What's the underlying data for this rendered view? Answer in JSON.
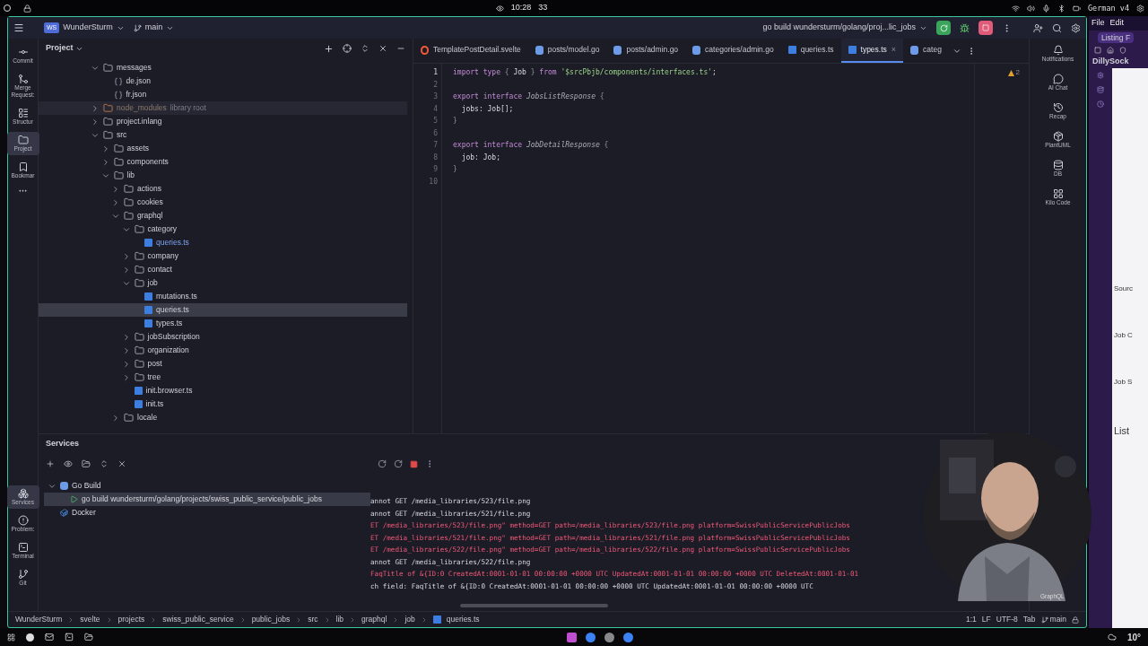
{
  "system_bar": {
    "time": "10:28",
    "count": "33",
    "keyboard": "German v4"
  },
  "title_bar": {
    "project_badge": "WS",
    "project": "WunderSturm",
    "branch": "main",
    "run_config": "go build wundersturm/golang/proj...lic_jobs"
  },
  "left_tools": [
    {
      "label": "Commit",
      "selected": false
    },
    {
      "label": "Merge Request:",
      "selected": false
    },
    {
      "label": "Structur",
      "selected": false
    },
    {
      "label": "Project",
      "selected": true
    },
    {
      "label": "Bookmar",
      "selected": false
    }
  ],
  "bottom_tools": [
    {
      "label": "Services",
      "selected": true
    },
    {
      "label": "Problem:",
      "selected": false
    },
    {
      "label": "Terminal",
      "selected": false
    },
    {
      "label": "Git",
      "selected": false
    }
  ],
  "project_panel": {
    "title": "Project",
    "tree": [
      {
        "name": "messages",
        "kind": "folder",
        "expanded": true,
        "selected": false,
        "children": [
          {
            "name": "de.json",
            "kind": "json",
            "selected": false
          },
          {
            "name": "fr.json",
            "kind": "json",
            "selected": false
          }
        ]
      },
      {
        "name": "node_modules",
        "suffix": "library root",
        "kind": "excluded",
        "expanded": false,
        "selected": false
      },
      {
        "name": "project.inlang",
        "kind": "folder",
        "expanded": false,
        "selected": false
      },
      {
        "name": "src",
        "kind": "folder",
        "expanded": true,
        "selected": false,
        "children": [
          {
            "name": "assets",
            "kind": "folder",
            "expanded": false,
            "selected": false
          },
          {
            "name": "components",
            "kind": "folder",
            "expanded": false,
            "selected": false
          },
          {
            "name": "lib",
            "kind": "folder",
            "expanded": true,
            "selected": false,
            "children": [
              {
                "name": "actions",
                "kind": "folder",
                "expanded": false,
                "selected": false
              },
              {
                "name": "cookies",
                "kind": "folder",
                "expanded": false,
                "selected": false
              },
              {
                "name": "graphql",
                "kind": "folder",
                "expanded": true,
                "selected": false,
                "children": [
                  {
                    "name": "category",
                    "kind": "folder",
                    "expanded": true,
                    "selected": false,
                    "children": [
                      {
                        "name": "queries.ts",
                        "kind": "ts",
                        "modified": true,
                        "selected": false
                      }
                    ]
                  },
                  {
                    "name": "company",
                    "kind": "folder",
                    "expanded": false,
                    "selected": false
                  },
                  {
                    "name": "contact",
                    "kind": "folder",
                    "expanded": false,
                    "selected": false
                  },
                  {
                    "name": "job",
                    "kind": "folder",
                    "expanded": true,
                    "selected": false,
                    "children": [
                      {
                        "name": "mutations.ts",
                        "kind": "ts",
                        "modified": false,
                        "selected": false
                      },
                      {
                        "name": "queries.ts",
                        "kind": "ts",
                        "modified": false,
                        "selected": true
                      },
                      {
                        "name": "types.ts",
                        "kind": "ts",
                        "modified": false,
                        "selected": false
                      }
                    ]
                  },
                  {
                    "name": "jobSubscription",
                    "kind": "folder",
                    "expanded": false,
                    "selected": false
                  },
                  {
                    "name": "organization",
                    "kind": "folder",
                    "expanded": false,
                    "selected": false
                  },
                  {
                    "name": "post",
                    "kind": "folder",
                    "expanded": false,
                    "selected": false
                  },
                  {
                    "name": "tree",
                    "kind": "folder",
                    "expanded": false,
                    "selected": false
                  },
                  {
                    "name": "init.browser.ts",
                    "kind": "ts",
                    "modified": false,
                    "selected": false
                  },
                  {
                    "name": "init.ts",
                    "kind": "ts",
                    "modified": false,
                    "selected": false
                  }
                ]
              },
              {
                "name": "locale",
                "kind": "folder",
                "expanded": false,
                "selected": false
              }
            ]
          }
        ]
      }
    ]
  },
  "tabs": [
    {
      "label": "TemplatePostDetail.svelte",
      "kind": "svelte",
      "selected": false
    },
    {
      "label": "posts/model.go",
      "kind": "go",
      "selected": false
    },
    {
      "label": "posts/admin.go",
      "kind": "go",
      "selected": false
    },
    {
      "label": "categories/admin.go",
      "kind": "go",
      "selected": false
    },
    {
      "label": "queries.ts",
      "kind": "ts",
      "selected": false
    },
    {
      "label": "types.ts",
      "kind": "ts",
      "selected": true,
      "close": "×"
    },
    {
      "label": "categ",
      "kind": "go",
      "selected": false
    }
  ],
  "editor": {
    "warnings": "2",
    "lines": [
      {
        "number": "1",
        "tokens": [
          {
            "kind": "keyword",
            "text": "import type "
          },
          {
            "kind": "punct",
            "text": "{ "
          },
          {
            "kind": "plain",
            "text": "Job "
          },
          {
            "kind": "punct",
            "text": "} "
          },
          {
            "kind": "keyword",
            "text": "from "
          },
          {
            "kind": "string",
            "text": "'$srcPbjb/components/interfaces.ts'"
          },
          {
            "kind": "plain",
            "text": ";"
          }
        ]
      },
      {
        "number": "2"
      },
      {
        "number": "3",
        "tokens": [
          {
            "kind": "keyword",
            "text": "export interface "
          },
          {
            "kind": "type",
            "text": "JobsListResponse "
          },
          {
            "kind": "punct",
            "text": "{"
          }
        ]
      },
      {
        "number": "4",
        "tokens": [
          {
            "kind": "plain",
            "text": "  jobs: Job[];"
          }
        ]
      },
      {
        "number": "5",
        "tokens": [
          {
            "kind": "punct",
            "text": "}"
          }
        ]
      },
      {
        "number": "6"
      },
      {
        "number": "7",
        "tokens": [
          {
            "kind": "keyword",
            "text": "export interface "
          },
          {
            "kind": "type",
            "text": "JobDetailResponse "
          },
          {
            "kind": "punct",
            "text": "{"
          }
        ]
      },
      {
        "number": "8",
        "tokens": [
          {
            "kind": "plain",
            "text": "  job: Job;"
          }
        ]
      },
      {
        "number": "9",
        "tokens": [
          {
            "kind": "punct",
            "text": "}"
          }
        ]
      },
      {
        "number": "10"
      }
    ]
  },
  "right_tools": [
    {
      "label": "Notifications"
    },
    {
      "label": "AI Chat"
    },
    {
      "label": "Recap"
    },
    {
      "label": "PlantUML"
    },
    {
      "label": "DB"
    },
    {
      "label": "Kilo Code"
    }
  ],
  "services": {
    "title": "Services",
    "tree": [
      {
        "name": "Go Build",
        "kind": "go",
        "expanded": true,
        "selected": false,
        "children": [
          {
            "name": "go build wundersturm/golang/projects/swiss_public_service/public_jobs",
            "kind": "run",
            "selected": true
          }
        ]
      },
      {
        "name": "Docker",
        "kind": "docker",
        "selected": false
      }
    ],
    "console": [
      {
        "text": "annot GET /media_libraries/523/file.png",
        "kind": "info"
      },
      {
        "text": "annot GET /media_libraries/521/file.png",
        "kind": "info"
      },
      {
        "text": "ET /media_libraries/523/file.png\" method=GET path=/media_libraries/523/file.png platform=SwissPublicServicePublicJobs",
        "kind": "error"
      },
      {
        "text": "ET /media_libraries/521/file.png\" method=GET path=/media_libraries/521/file.png platform=SwissPublicServicePublicJobs",
        "kind": "error"
      },
      {
        "text": "ET /media_libraries/522/file.png\" method=GET path=/media_libraries/522/file.png platform=SwissPublicServicePublicJobs",
        "kind": "error"
      },
      {
        "text": "annot GET /media_libraries/522/file.png",
        "kind": "info"
      },
      {
        "text": "FaqTitle of &{ID:0 CreatedAt:0001-01-01 00:00:00 +0000 UTC UpdatedAt:0001-01-01 00:00:00 +0000 UTC DeletedAt:0001-01-01",
        "kind": "error"
      },
      {
        "text": "ch field: FaqTitle of &{ID:0 CreatedAt:0001-01-01 00:00:00 +0000 UTC UpdatedAt:0001-01-01 00:00:00 +0000 UTC",
        "kind": "info"
      }
    ]
  },
  "webcam_label": "GraphQL",
  "status_bar": {
    "breadcrumbs": [
      "WunderSturm",
      "svelte",
      "projects",
      "swiss_public_service",
      "public_jobs",
      "src",
      "lib",
      "graphql",
      "job",
      "queries.ts"
    ],
    "position": "1:1",
    "line_ending": "LF",
    "encoding": "UTF-8",
    "indent": "Tab",
    "branch": "main"
  },
  "browser": {
    "menu": [
      "File",
      "Edit"
    ],
    "tab": "Listing F",
    "site": "DillySock",
    "fragments": [
      "Sourc",
      "Job C",
      "Job S"
    ],
    "heading": "List"
  },
  "taskbar": {
    "weather": "10°"
  }
}
